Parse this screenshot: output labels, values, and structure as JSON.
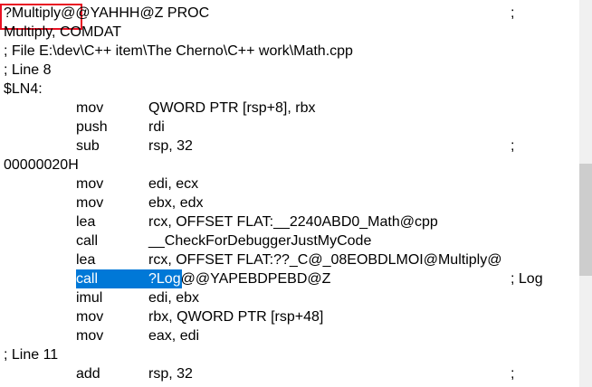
{
  "colors": {
    "selection": "#0078d7",
    "highlight_box": "#e81123",
    "scrollbar_track": "#f0f0f0",
    "scrollbar_thumb": "#cdcdcd"
  },
  "lines": [
    {
      "text": "?Multiply@@YAHHH@Z PROC",
      "comment": ";"
    },
    {
      "text": "Multiply, COMDAT"
    },
    {
      "text": "; File E:\\dev\\C++ item\\The Cherno\\C++ work\\Math.cpp"
    },
    {
      "text": "; Line 8"
    },
    {
      "text": "$LN4:"
    },
    {
      "op": "mov",
      "args": "QWORD PTR [rsp+8], rbx"
    },
    {
      "op": "push",
      "args": "rdi"
    },
    {
      "op": "sub",
      "args": "rsp, 32",
      "comment": ";"
    },
    {
      "text": "00000020H"
    },
    {
      "op": "mov",
      "args": "edi, ecx"
    },
    {
      "op": "mov",
      "args": "ebx, edx"
    },
    {
      "op": "lea",
      "args": "rcx, OFFSET FLAT:__2240ABD0_Math@cpp"
    },
    {
      "op": "call",
      "args": "__CheckForDebuggerJustMyCode"
    },
    {
      "op": "lea",
      "args": "rcx, OFFSET FLAT:??_C@_08EOBDLMOI@Multiply@"
    },
    {
      "op": "call",
      "args": "?Log@@YAPEBDPEBD@Z",
      "comment": "; Log",
      "selected": true
    },
    {
      "op": "imul",
      "args": "edi, ebx"
    },
    {
      "op": "mov",
      "args": "rbx, QWORD PTR [rsp+48]"
    },
    {
      "op": "mov",
      "args": "eax, edi"
    },
    {
      "text": "; Line 11"
    },
    {
      "op": "add",
      "args": "rsp, 32",
      "comment": ";"
    }
  ],
  "selection": {
    "line": 14,
    "op": "call",
    "args_selected": "?Log",
    "args_rest": "@@YAPEBDPEBD@Z"
  },
  "highlight": {
    "line": 0,
    "boxed": "?Multiply@",
    "rest": "@YAHHH@Z PROC"
  },
  "scrollbar": {
    "position_fraction": 0.42,
    "visible_fraction": 0.29
  }
}
